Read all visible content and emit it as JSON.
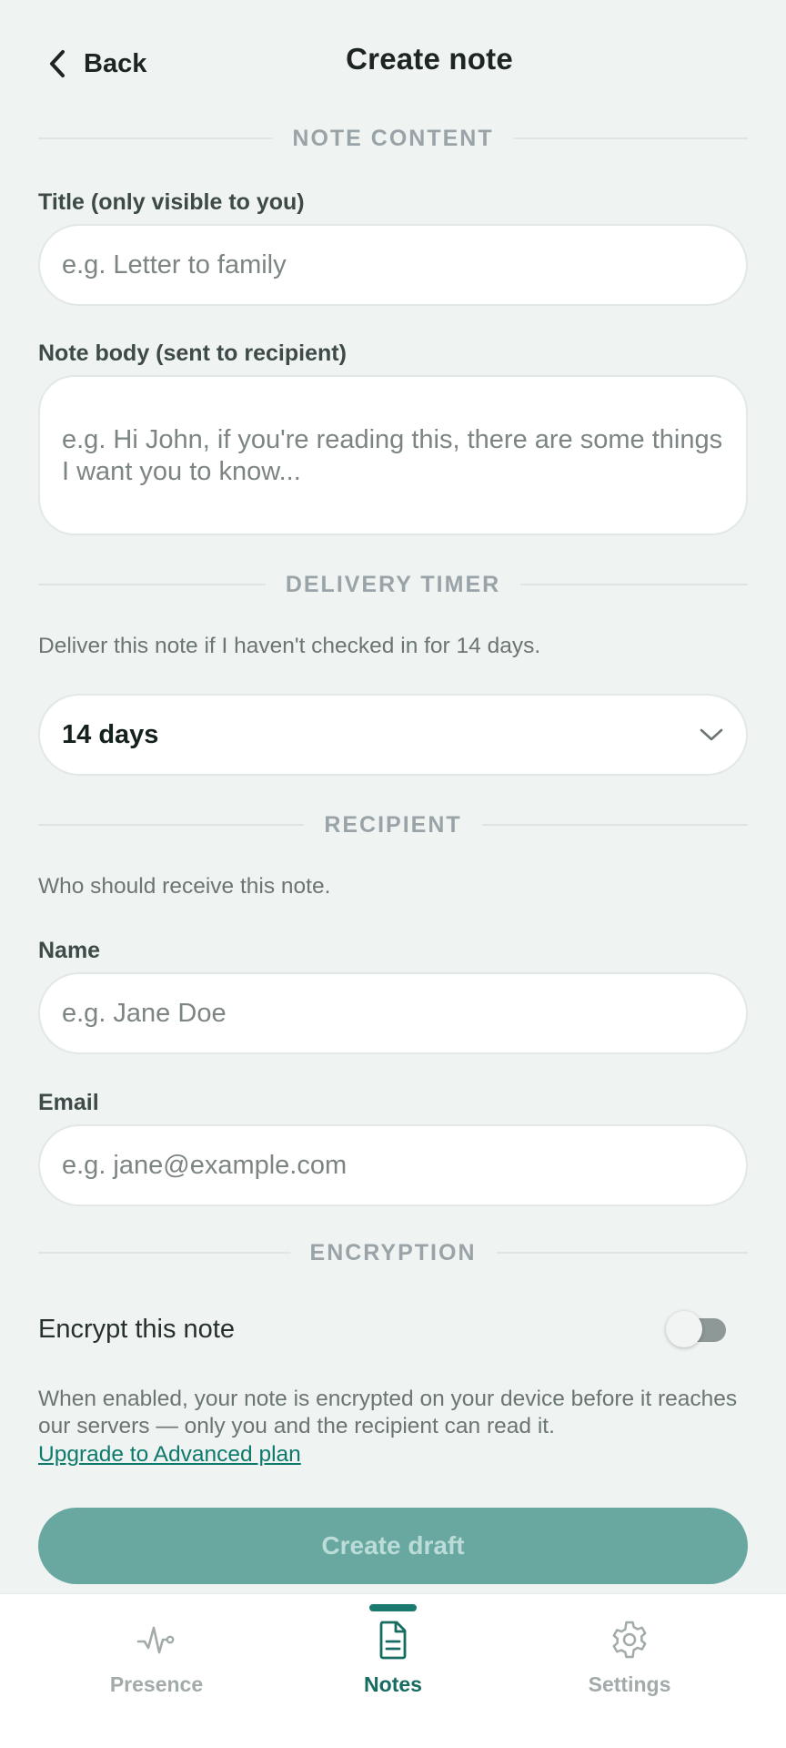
{
  "header": {
    "back_label": "Back",
    "title": "Create note"
  },
  "sections": {
    "note_content": "NOTE CONTENT",
    "delivery_timer": "DELIVERY TIMER",
    "recipient": "RECIPIENT",
    "encryption": "ENCRYPTION"
  },
  "note": {
    "title_label": "Title (only visible to you)",
    "title_placeholder": "e.g. Letter to family",
    "title_value": "",
    "body_label": "Note body (sent to recipient)",
    "body_placeholder": "e.g. Hi John, if you're reading this, there are some things I want you to know...",
    "body_value": ""
  },
  "timer": {
    "helper": "Deliver this note if I haven't checked in for 14 days.",
    "selected": "14 days"
  },
  "recipient": {
    "helper": "Who should receive this note.",
    "name_label": "Name",
    "name_placeholder": "e.g. Jane Doe",
    "name_value": "",
    "email_label": "Email",
    "email_placeholder": "e.g. jane@example.com",
    "email_value": ""
  },
  "encryption": {
    "toggle_label": "Encrypt this note",
    "toggle_on": false,
    "description": "When enabled, your note is encrypted on your device before it reaches our servers — only you and the recipient can read it.",
    "upgrade_link": "Upgrade to Advanced plan"
  },
  "actions": {
    "create_draft": "Create draft"
  },
  "nav": {
    "items": [
      {
        "label": "Presence",
        "icon": "activity-icon",
        "active": false
      },
      {
        "label": "Notes",
        "icon": "document-icon",
        "active": true
      },
      {
        "label": "Settings",
        "icon": "gear-icon",
        "active": false
      }
    ]
  },
  "colors": {
    "accent": "#1a7a6d",
    "button_disabled": "#68a8a1",
    "background": "#eff3f2"
  }
}
